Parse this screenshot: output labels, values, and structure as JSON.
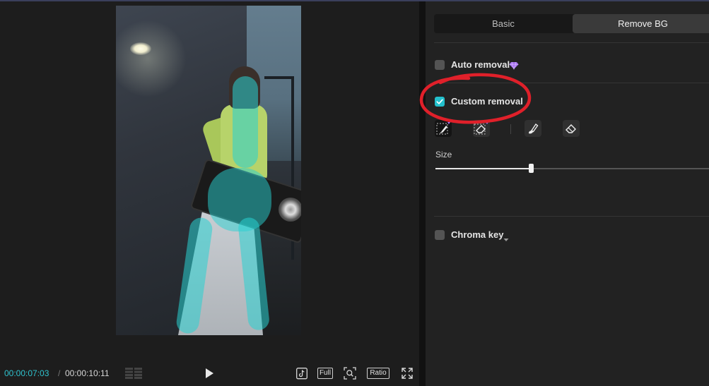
{
  "player": {
    "time_current": "00:00:07:03",
    "time_separator": "/",
    "time_total": "00:00:10:11",
    "full_label": "Full",
    "ratio_label": "Ratio",
    "icons": [
      "grid-icon",
      "play-icon",
      "tiktok-icon",
      "zoom-icon",
      "fullscreen-icon"
    ]
  },
  "panel": {
    "tabs": [
      {
        "label": "Basic",
        "active": false
      },
      {
        "label": "Remove BG",
        "active": true
      }
    ],
    "auto_removal": {
      "label": "Auto removal",
      "checked": false,
      "badge": "premium-gem-icon"
    },
    "custom_removal": {
      "label": "Custom removal",
      "checked": true
    },
    "tools": [
      "smart-brush-icon",
      "smart-eraser-icon",
      "brush-icon",
      "eraser-icon"
    ],
    "size": {
      "label": "Size",
      "value": 0.35
    },
    "chroma_key": {
      "label": "Chroma key",
      "checked": false
    }
  },
  "colors": {
    "accent": "#23c0cc",
    "timecode": "#2fc3cf",
    "premium": "#a872f0",
    "annotation": "#e0202a"
  }
}
